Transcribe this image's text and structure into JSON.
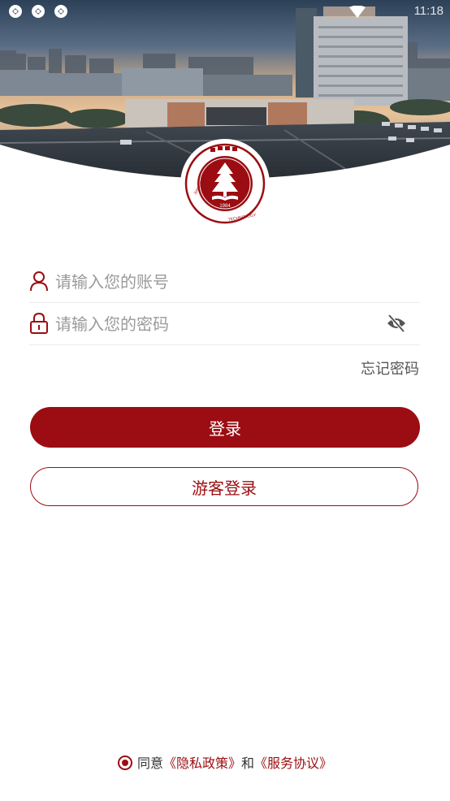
{
  "status_bar": {
    "time": "11:18",
    "notification_icons": [
      "app-notification-icon",
      "app-notification-icon",
      "app-notification-icon"
    ],
    "wifi_icon": "wifi-icon"
  },
  "header": {
    "image": "campus-gate-aerial-photo",
    "logo": {
      "icon": "university-seal-icon",
      "year_text": "1984",
      "ring_text": "JIANGSU UNIVERSITY OF TECHNOLOGY",
      "top_text": "江苏理工学院"
    }
  },
  "login": {
    "account_placeholder": "请输入您的账号",
    "account_value": "",
    "account_icon": "user-icon",
    "password_placeholder": "请输入您的密码",
    "password_value": "",
    "password_icon": "lock-icon",
    "visibility_icon": "eye-off-icon",
    "forgot_label": "忘记密码",
    "login_label": "登录",
    "guest_label": "游客登录"
  },
  "agreement": {
    "prefix": "同意",
    "privacy_label": "《隐私政策》",
    "and": "和",
    "service_label": "《服务协议》",
    "checked": true
  },
  "colors": {
    "brand": "#9b0d12",
    "placeholder": "#9a9a9a",
    "divider": "#ececec"
  }
}
